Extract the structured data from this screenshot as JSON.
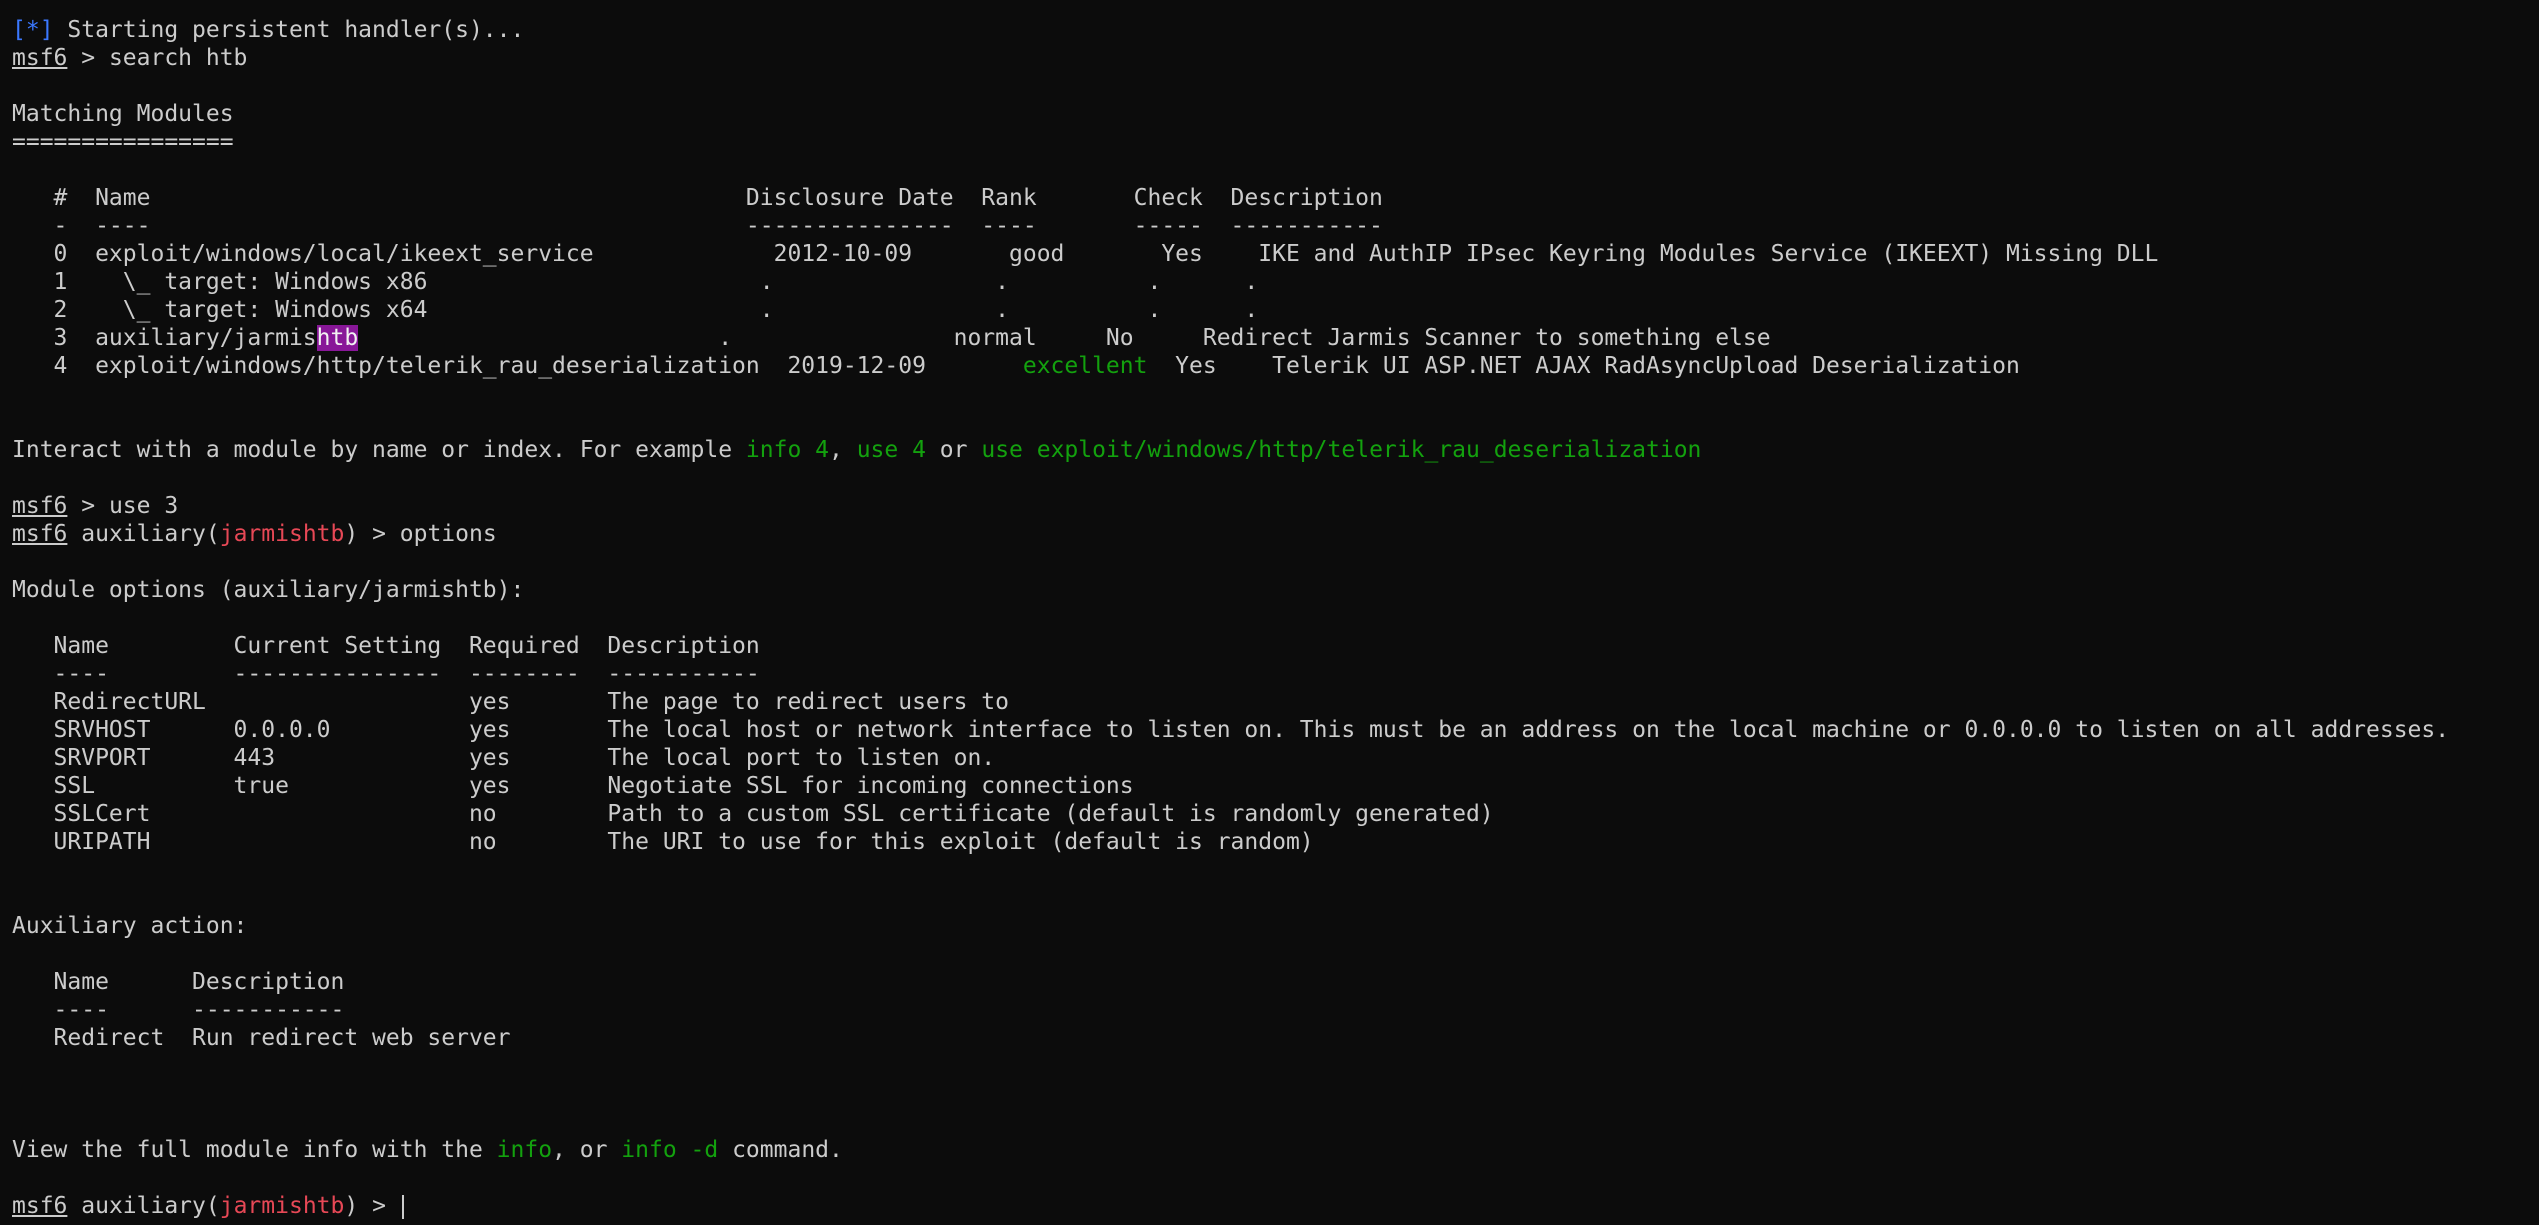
{
  "colors": {
    "background": "#0c0c0c",
    "foreground": "#cccccc",
    "status_blue": "#3b78ff",
    "green": "#13a10e",
    "red": "#e74856",
    "highlight": "#881798"
  },
  "prompt": {
    "name": "msf6",
    "module_prefix": "auxiliary(",
    "module_name": "jarmishtb",
    "module_suffix": ")",
    "arrow": " > "
  },
  "startup": {
    "marker": "[*]",
    "message": " Starting persistent handler(s)..."
  },
  "commands": {
    "search": "search htb",
    "use": "use 3",
    "options": "options"
  },
  "search_results": {
    "title": "Matching Modules",
    "underline": "================",
    "header": "   #  Name                                           Disclosure Date  Rank       Check  Description",
    "divider": "   -  ----                                           ---------------  ----       -----  -----------",
    "rows": [
      {
        "text": "   0  exploit/windows/local/ikeext_service             2012-10-09       good       Yes    IKE and AuthIP IPsec Keyring Modules Service (IKEEXT) Missing DLL"
      },
      {
        "text": "   1    \\_ target: Windows x86                        .                .          .      ."
      },
      {
        "text": "   2    \\_ target: Windows x64                        .                .          .      ."
      },
      {
        "pre": "   3  auxiliary/jarmis",
        "match": "htb",
        "post": "                          .                normal     No     Redirect Jarmis Scanner to something else"
      },
      {
        "pre": "   4  exploit/windows/http/telerik_rau_deserialization  2019-12-09       ",
        "rank": "excellent",
        "post": "  Yes    Telerik UI ASP.NET AJAX RadAsyncUpload Deserialization"
      }
    ]
  },
  "interact_hint": {
    "text1": "Interact with a module by name or index. For example ",
    "cmd1": "info 4",
    "text2": ", ",
    "cmd2": "use 4",
    "text3": " or ",
    "cmd3": "use exploit/windows/http/telerik_rau_deserialization"
  },
  "module_options": {
    "title": "Module options (auxiliary/jarmishtb):",
    "header": "   Name         Current Setting  Required  Description",
    "divider": "   ----         ---------------  --------  -----------",
    "rows": [
      "   RedirectURL                   yes       The page to redirect users to",
      "   SRVHOST      0.0.0.0          yes       The local host or network interface to listen on. This must be an address on the local machine or 0.0.0.0 to listen on all addresses.",
      "   SRVPORT      443              yes       The local port to listen on.",
      "   SSL          true             yes       Negotiate SSL for incoming connections",
      "   SSLCert                       no        Path to a custom SSL certificate (default is randomly generated)",
      "   URIPATH                       no        The URI to use for this exploit (default is random)"
    ]
  },
  "auxiliary_action": {
    "title": "Auxiliary action:",
    "header": "   Name      Description",
    "divider": "   ----      -----------",
    "rows": [
      "   Redirect  Run redirect web server"
    ]
  },
  "info_hint": {
    "text1": "View the full module info with the ",
    "cmd1": "info",
    "text2": ", or ",
    "cmd2": "info -d",
    "text3": " command."
  }
}
